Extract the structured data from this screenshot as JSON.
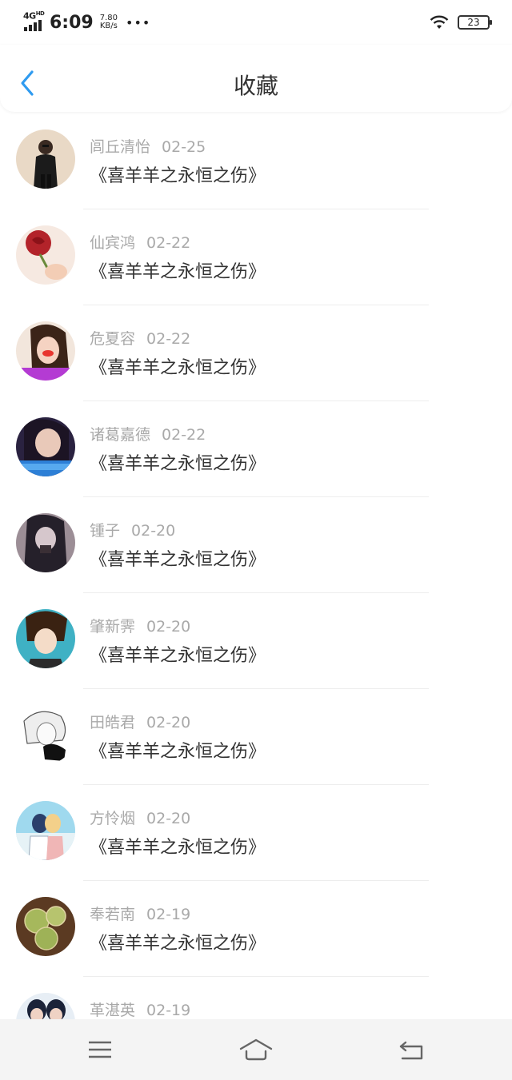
{
  "status_bar": {
    "network": "4G",
    "network_sub": "HD",
    "time": "6:09",
    "speed_value": "7.80",
    "speed_unit": "KB/s",
    "more": "•••",
    "battery": "23"
  },
  "header": {
    "title": "收藏",
    "back_icon": "chevron-left-icon",
    "accent_color": "#2f9bf0"
  },
  "items": [
    {
      "name": "闾丘清怡",
      "date": "02-25",
      "book": "《喜羊羊之永恒之伤》",
      "avatar": "man-in-black-avatar"
    },
    {
      "name": "仙宾鸿",
      "date": "02-22",
      "book": "《喜羊羊之永恒之伤》",
      "avatar": "red-rose-avatar"
    },
    {
      "name": "危夏容",
      "date": "02-22",
      "book": "《喜羊羊之永恒之伤》",
      "avatar": "girl-photo-avatar"
    },
    {
      "name": "诸葛嘉德",
      "date": "02-22",
      "book": "《喜羊羊之永恒之伤》",
      "avatar": "girl-selfie-avatar"
    },
    {
      "name": "锺子",
      "date": "02-20",
      "book": "《喜羊羊之永恒之伤》",
      "avatar": "girl-bw-avatar"
    },
    {
      "name": "肇新霁",
      "date": "02-20",
      "book": "《喜羊羊之永恒之伤》",
      "avatar": "anime-boy-avatar"
    },
    {
      "name": "田皓君",
      "date": "02-20",
      "book": "《喜羊羊之永恒之伤》",
      "avatar": "anime-sketch-avatar"
    },
    {
      "name": "方怜烟",
      "date": "02-20",
      "book": "《喜羊羊之永恒之伤》",
      "avatar": "anime-couple-avatar"
    },
    {
      "name": "奉若南",
      "date": "02-19",
      "book": "《喜羊羊之永恒之伤》",
      "avatar": "cactus-avatar"
    },
    {
      "name": "革湛英",
      "date": "02-19",
      "book": "",
      "avatar": "couple-photo-avatar"
    }
  ],
  "nav": {
    "menu_icon": "menu-icon",
    "home_icon": "home-icon",
    "back_icon": "back-icon"
  }
}
